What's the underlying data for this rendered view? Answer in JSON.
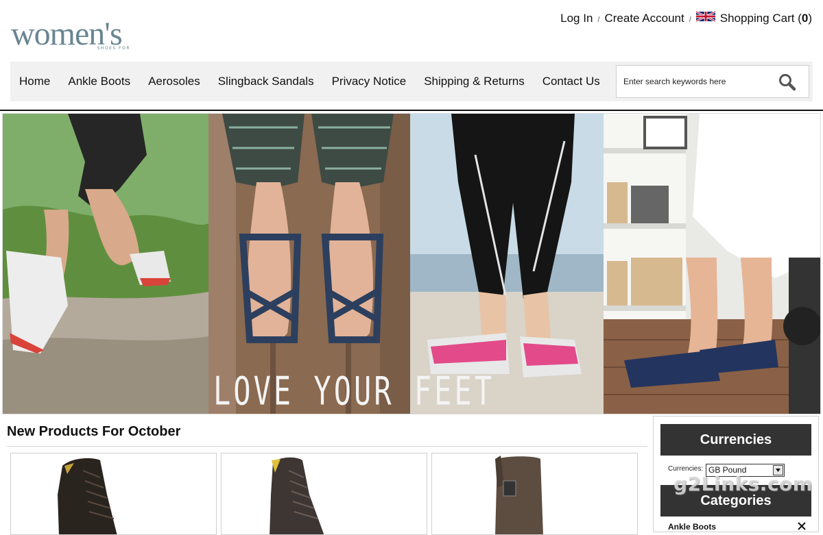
{
  "brand": {
    "logo_text": "women's",
    "logo_subtext": "SHOES FOR"
  },
  "top_links": {
    "login": "Log In",
    "separator": "/",
    "create_account": "Create Account",
    "cart_label": "Shopping Cart (",
    "cart_count": "0",
    "cart_close": ")"
  },
  "nav": {
    "items": [
      "Home",
      "Ankle Boots",
      "Aerosoles",
      "Slingback Sandals",
      "Privacy Notice",
      "Shipping & Returns",
      "Contact Us"
    ]
  },
  "search": {
    "placeholder": "Enter search keywords here",
    "icon": "search-icon"
  },
  "hero": {
    "caption": "LOVE YOUR FEET"
  },
  "main": {
    "section_title": "New Products For October",
    "products": [
      {
        "image": "black-lace-up-boot"
      },
      {
        "image": "brown-lace-up-boot"
      },
      {
        "image": "brown-pull-on-boot"
      }
    ]
  },
  "sidebar": {
    "currencies_title": "Currencies",
    "currencies_label": "Currencies:",
    "currency_selected": "GB Pound",
    "categories_title": "Categories",
    "category_first": "Ankle Boots"
  },
  "watermark": "g2Links.com",
  "colors": {
    "logo": "#6a8592",
    "nav_bg": "#f1f1f1",
    "sidebar_head": "#333333"
  }
}
